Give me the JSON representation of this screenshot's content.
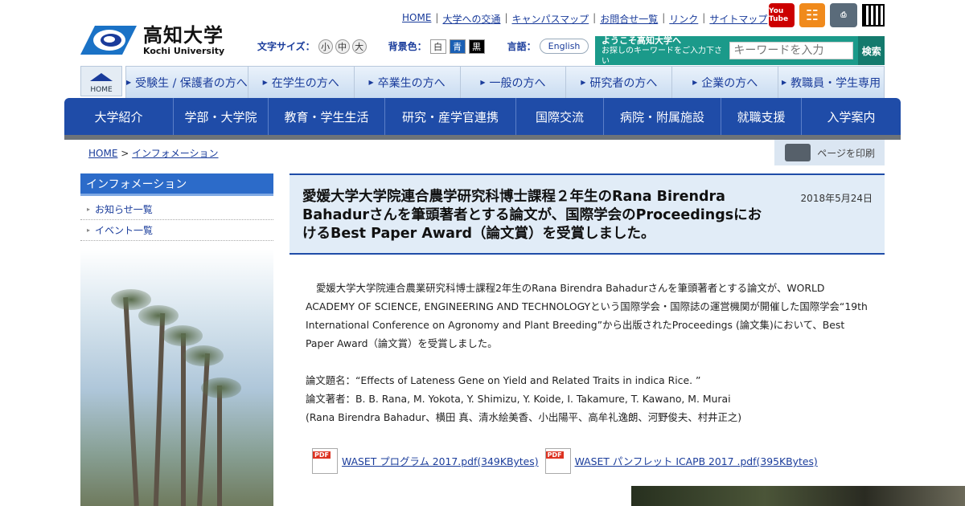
{
  "header": {
    "logo_jp": "高知大学",
    "logo_en": "Kochi University",
    "util_links": [
      "HOME",
      "大学への交通",
      "キャンパスマップ",
      "お問合せ一覧",
      "リンク",
      "サイトマップ"
    ],
    "icons": [
      "youtube-icon",
      "rss-icon",
      "print-icon",
      "qr-code-icon"
    ],
    "youtube_label": "You Tube",
    "font_size_label": "文字サイズ：",
    "font_sizes": [
      "小",
      "中",
      "大"
    ],
    "bg_label": "背景色：",
    "bg_options": [
      "白",
      "青",
      "黒"
    ],
    "lang_label": "言語：",
    "lang_button": "English",
    "search": {
      "welcome": "ようこそ高知大学へ",
      "welcome_sub": "お探しのキーワードをご入力下さい",
      "placeholder": "キーワードを入力",
      "button": "検索"
    },
    "home_button": "HOME"
  },
  "audience_tabs": [
    "受験生 / 保護者の方へ",
    "在学生の方へ",
    "卒業生の方へ",
    "一般の方へ",
    "研究者の方へ",
    "企業の方へ",
    "教職員・学生専用"
  ],
  "main_nav": [
    "大学紹介",
    "学部・大学院",
    "教育・学生生活",
    "研究・産学官連携",
    "国際交流",
    "病院・附属施設",
    "就職支援",
    "入学案内"
  ],
  "breadcrumb": {
    "home": "HOME",
    "sep": ">",
    "current": "インフォメーション"
  },
  "print_button": "ページを印刷",
  "sidebar": {
    "heading": "インフォメーション",
    "items": [
      "お知らせ一覧",
      "イベント一覧"
    ]
  },
  "article": {
    "title": "愛媛大学大学院連合農学研究科博士課程２年生のRana Birendra Bahadurさんを筆頭著者とする論文が、国際学会のProceedingsにおけるBest Paper Award（論文賞）を受賞しました。",
    "date": "2018年5月24日",
    "paragraph": "愛媛大学大学院連合農業研究科博士課程2年生のRana Birendra Bahadurさんを筆頭著者とする論文が、WORLD ACADEMY OF SCIENCE, ENGINEERING AND TECHNOLOGYという国際学会・国際誌の運営機関が開催した国際学会“19th International Conference on Agronomy and Plant Breeding”から出版されたProceedings (論文集)において、Best Paper Award（論文賞）を受賞しました。",
    "paper_title": "論文題名：“Effects of Lateness Gene on Yield and Related Traits in indica Rice. ”",
    "authors": "論文著者：B. B. Rana, M. Yokota, Y. Shimizu, Y. Koide, I. Takamure, T. Kawano, M. Murai",
    "authors_jp": "(Rana Birendra Bahadur、横田 真、清水絵美香、小出陽平、高牟礼逸朗、河野俊夫、村井正之)",
    "pdf_badge": "PDF",
    "pdfs": [
      "WASET プログラム 2017.pdf(349KBytes)",
      "WASET パンフレット ICAPB 2017 .pdf(395KBytes)"
    ]
  }
}
